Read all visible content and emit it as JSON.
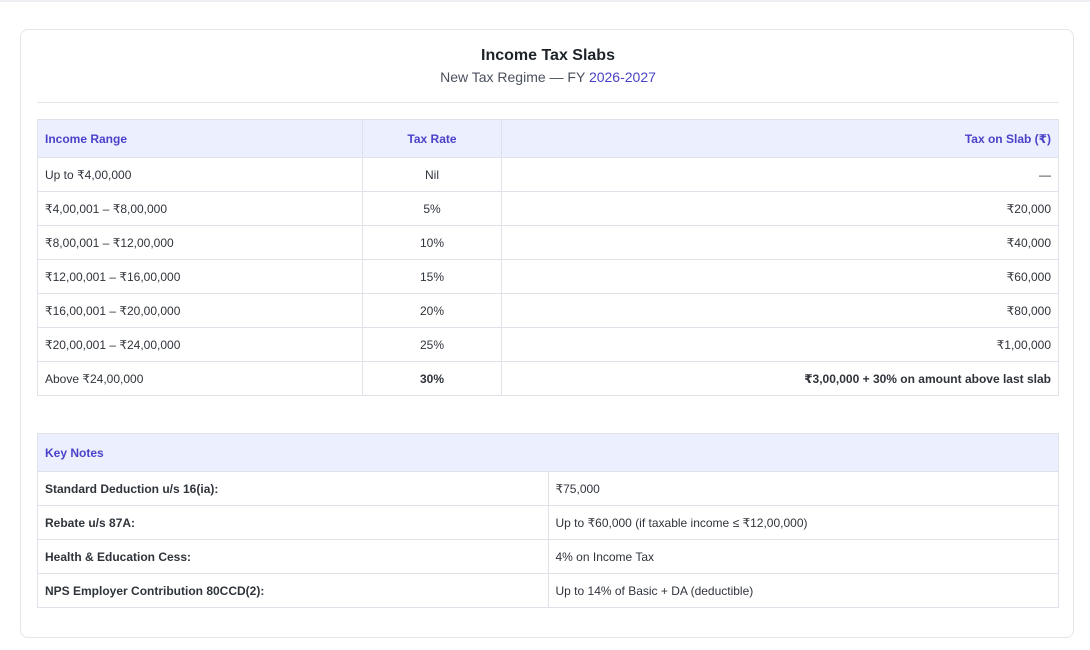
{
  "header": {
    "title": "Income Tax Slabs",
    "subtitle_prefix": "New Tax Regime — FY ",
    "fiscal_year": "2026-2027"
  },
  "slab_table": {
    "columns": [
      "Income Range",
      "Tax Rate",
      "Tax on Slab (₹)"
    ],
    "rows": [
      {
        "range": "Up to ₹4,00,000",
        "rate": "Nil",
        "tax": "—"
      },
      {
        "range": "₹4,00,001 – ₹8,00,000",
        "rate": "5%",
        "tax": "₹20,000"
      },
      {
        "range": "₹8,00,001 – ₹12,00,000",
        "rate": "10%",
        "tax": "₹40,000"
      },
      {
        "range": "₹12,00,001 – ₹16,00,000",
        "rate": "15%",
        "tax": "₹60,000"
      },
      {
        "range": "₹16,00,001 – ₹20,00,000",
        "rate": "20%",
        "tax": "₹80,000"
      },
      {
        "range": "₹20,00,001 – ₹24,00,000",
        "rate": "25%",
        "tax": "₹1,00,000"
      },
      {
        "range": "Above ₹24,00,000",
        "rate": "30%",
        "tax": "₹3,00,000 + 30% on amount above last slab"
      }
    ]
  },
  "notes_table": {
    "heading": "Key Notes",
    "rows": [
      {
        "label": "Standard Deduction u/s 16(ia):",
        "value": "₹75,000"
      },
      {
        "label": "Rebate u/s 87A:",
        "value": "Up to ₹60,000 (if taxable income ≤ ₹12,00,000)"
      },
      {
        "label": "Health & Education Cess:",
        "value": "4% on Income Tax"
      },
      {
        "label": "NPS Employer Contribution 80CCD(2):",
        "value": "Up to 14% of Basic + DA (deductible)"
      }
    ]
  },
  "colors": {
    "accent": "#4a43c9",
    "highlight": "#7a2fc9",
    "header_bg": "#eceffd",
    "border": "#dfe2e8"
  }
}
